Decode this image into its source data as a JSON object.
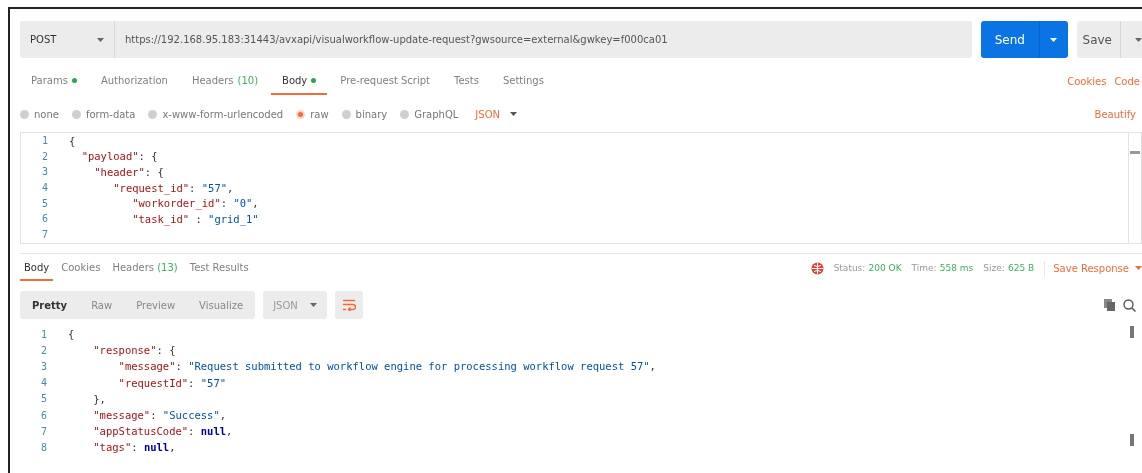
{
  "request": {
    "method": "POST",
    "url": "https://192.168.95.183:31443/avxapi/visualworkflow-update-request?gwsource=external&gwkey=f000ca01",
    "send": "Send",
    "save": "Save"
  },
  "request_tabs": [
    {
      "label": "Params",
      "dot": true,
      "selected": false
    },
    {
      "label": "Authorization",
      "dot": false,
      "selected": false
    },
    {
      "label": "Headers",
      "count": "(10)",
      "dot": false,
      "selected": false
    },
    {
      "label": "Body",
      "dot": true,
      "selected": true
    },
    {
      "label": "Pre-request Script",
      "dot": false,
      "selected": false
    },
    {
      "label": "Tests",
      "dot": false,
      "selected": false
    },
    {
      "label": "Settings",
      "dot": false,
      "selected": false
    }
  ],
  "request_links": [
    "Cookies",
    "Code"
  ],
  "body_types": [
    {
      "label": "none",
      "selected": false
    },
    {
      "label": "form-data",
      "selected": false
    },
    {
      "label": "x-www-form-urlencoded",
      "selected": false
    },
    {
      "label": "raw",
      "selected": true
    },
    {
      "label": "binary",
      "selected": false
    },
    {
      "label": "GraphQL",
      "selected": false
    }
  ],
  "body_format": "JSON",
  "beautify": "Beautify",
  "request_body": [
    {
      "n": "1",
      "tokens": [
        {
          "kind": "punct",
          "text": "{"
        }
      ]
    },
    {
      "n": "2",
      "tokens": [
        {
          "kind": "key",
          "text": "  \"payload\""
        },
        {
          "kind": "punct",
          "text": ": {"
        }
      ]
    },
    {
      "n": "3",
      "tokens": [
        {
          "kind": "key",
          "text": "    \"header\""
        },
        {
          "kind": "punct",
          "text": ": {"
        }
      ]
    },
    {
      "n": "4",
      "tokens": [
        {
          "kind": "key",
          "text": "       \"request_id\""
        },
        {
          "kind": "punct",
          "text": ": "
        },
        {
          "kind": "string",
          "text": "\"57\""
        },
        {
          "kind": "punct",
          "text": ","
        }
      ]
    },
    {
      "n": "5",
      "tokens": [
        {
          "kind": "key",
          "text": "          \"workorder_id\""
        },
        {
          "kind": "punct",
          "text": ": "
        },
        {
          "kind": "string",
          "text": "\"0\""
        },
        {
          "kind": "punct",
          "text": ","
        }
      ]
    },
    {
      "n": "6",
      "tokens": [
        {
          "kind": "key",
          "text": "          \"task_id\""
        },
        {
          "kind": "punct",
          "text": " : "
        },
        {
          "kind": "string",
          "text": "\"grid_1\""
        }
      ]
    },
    {
      "n": "7"
    }
  ],
  "response_tabs": [
    {
      "label": "Body",
      "selected": true
    },
    {
      "label": "Cookies",
      "selected": false
    },
    {
      "label": "Headers",
      "count": "(13)",
      "selected": false
    },
    {
      "label": "Test Results",
      "selected": false
    }
  ],
  "status": {
    "status_label": "Status:",
    "status": "200 OK",
    "time_label": "Time:",
    "time": "558 ms",
    "size_label": "Size:",
    "size": "625 B",
    "save_response": "Save Response"
  },
  "view_modes": [
    {
      "label": "Pretty",
      "selected": true
    },
    {
      "label": "Raw",
      "selected": false
    },
    {
      "label": "Preview",
      "selected": false
    },
    {
      "label": "Visualize",
      "selected": false
    }
  ],
  "response_format": "JSON",
  "response_body": [
    {
      "n": "1",
      "tokens": [
        {
          "kind": "punct",
          "text": "{"
        }
      ]
    },
    {
      "n": "2",
      "tokens": [
        {
          "kind": "key",
          "text": "    \"response\""
        },
        {
          "kind": "punct",
          "text": ": {"
        }
      ]
    },
    {
      "n": "3",
      "tokens": [
        {
          "kind": "key",
          "text": "        \"message\""
        },
        {
          "kind": "punct",
          "text": ": "
        },
        {
          "kind": "string",
          "text": "\"Request submitted to workflow engine for processing workflow request 57\""
        },
        {
          "kind": "punct",
          "text": ","
        }
      ]
    },
    {
      "n": "4",
      "tokens": [
        {
          "kind": "key",
          "text": "        \"requestId\""
        },
        {
          "kind": "punct",
          "text": ": "
        },
        {
          "kind": "string",
          "text": "\"57\""
        }
      ]
    },
    {
      "n": "5",
      "tokens": [
        {
          "kind": "punct",
          "text": "    },"
        }
      ]
    },
    {
      "n": "6",
      "tokens": [
        {
          "kind": "key",
          "text": "    \"message\""
        },
        {
          "kind": "punct",
          "text": ": "
        },
        {
          "kind": "string",
          "text": "\"Success\""
        },
        {
          "kind": "punct",
          "text": ","
        }
      ]
    },
    {
      "n": "7",
      "tokens": [
        {
          "kind": "key",
          "text": "    \"appStatusCode\""
        },
        {
          "kind": "punct",
          "text": ": "
        },
        {
          "kind": "literal",
          "text": "null"
        },
        {
          "kind": "punct",
          "text": ","
        }
      ]
    },
    {
      "n": "8",
      "tokens": [
        {
          "kind": "key",
          "text": "    \"tags\""
        },
        {
          "kind": "punct",
          "text": ": "
        },
        {
          "kind": "literal",
          "text": "null"
        },
        {
          "kind": "punct",
          "text": ","
        }
      ]
    }
  ]
}
